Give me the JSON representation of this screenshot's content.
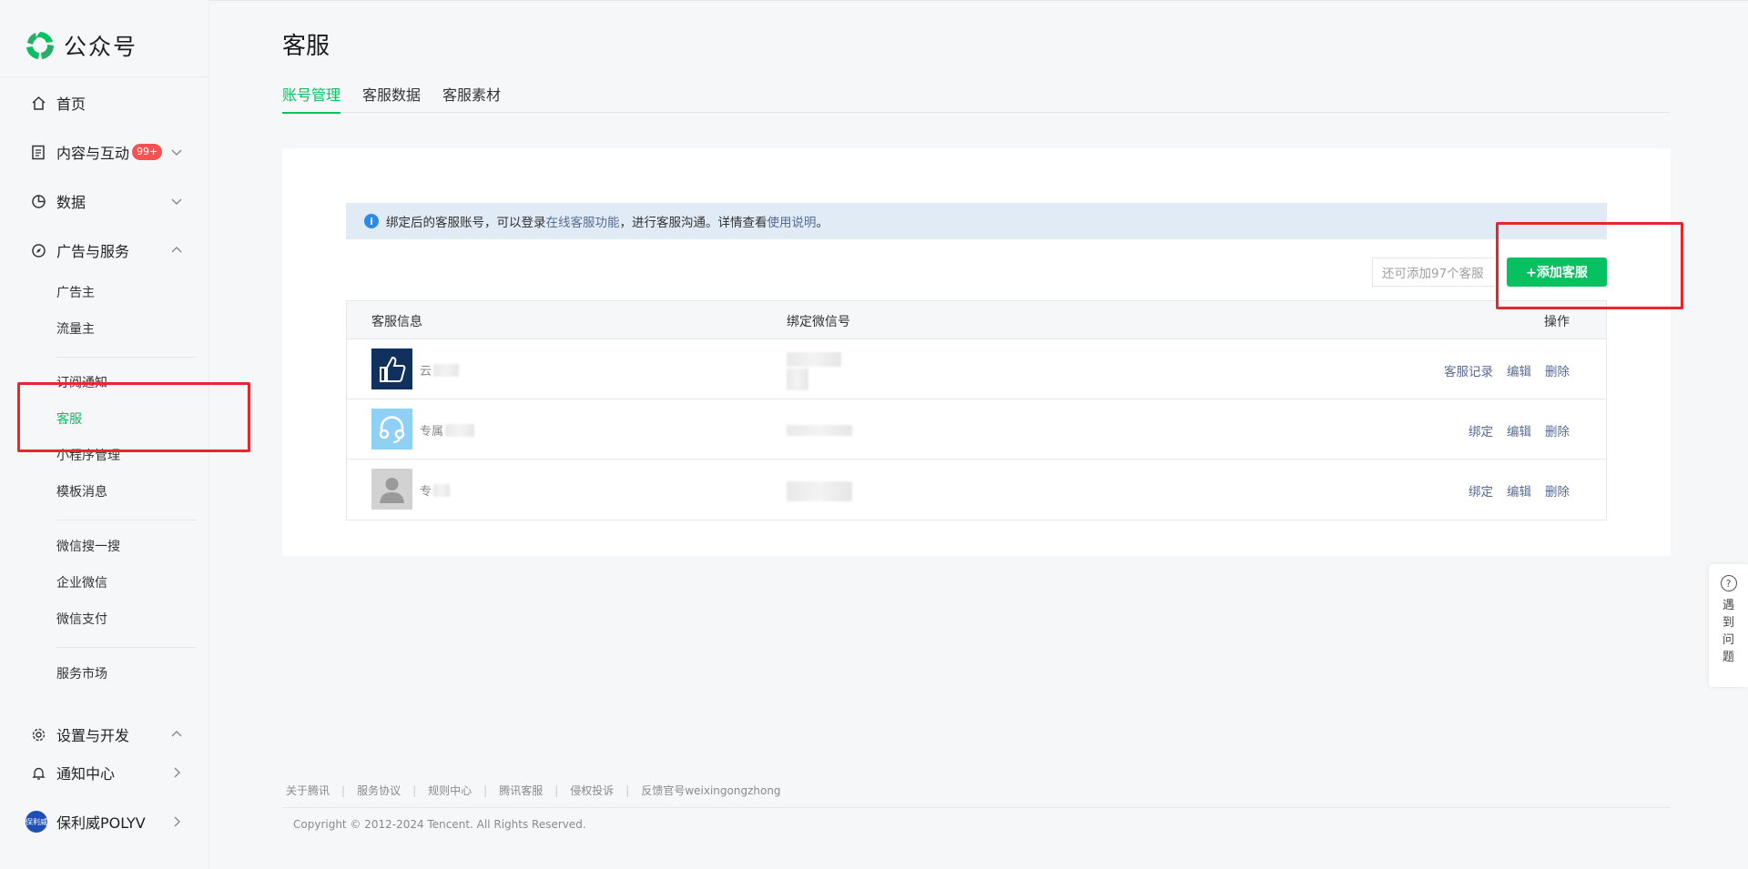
{
  "brand": {
    "name": "公众号"
  },
  "sidebar": {
    "home": "首页",
    "content": {
      "label": "内容与互动",
      "badge": "99+"
    },
    "data": "数据",
    "ads": {
      "label": "广告与服务",
      "subs": [
        "广告主",
        "流量主",
        "订阅通知",
        "客服",
        "小程序管理",
        "模板消息",
        "微信搜一搜",
        "企业微信",
        "微信支付",
        "服务市场"
      ]
    },
    "settings": "设置与开发",
    "notify": "通知中心",
    "account": {
      "name": "保利威POLYV",
      "avatar_text": "保利威"
    }
  },
  "page": {
    "title": "客服",
    "tabs": [
      "账号管理",
      "客服数据",
      "客服素材"
    ]
  },
  "notice": {
    "text1": "绑定后的客服账号，可以登录",
    "link1": "在线客服功能",
    "text2": "，进行客服沟通。详情查看",
    "link2": "使用说明",
    "text3": "。"
  },
  "remain_text": "还可添加97个客服",
  "add_button": "+添加客服",
  "table": {
    "headers": {
      "info": "客服信息",
      "wechat": "绑定微信号",
      "ops": "操作"
    },
    "rows": [
      {
        "name": "云",
        "ops": [
          "客服记录",
          "编辑",
          "删除"
        ]
      },
      {
        "name": "专属",
        "ops": [
          "绑定",
          "编辑",
          "删除"
        ]
      },
      {
        "name": "专",
        "ops": [
          "绑定",
          "编辑",
          "删除"
        ]
      }
    ]
  },
  "footer": {
    "links": [
      "关于腾讯",
      "服务协议",
      "规则中心",
      "腾讯客服",
      "侵权投诉",
      "反馈官号weixingongzhong"
    ],
    "copyright": "Copyright © 2012-2024 Tencent. All Rights Reserved."
  },
  "help": {
    "icon": "?",
    "label": "遇到问题"
  },
  "colors": {
    "accent": "#07c160",
    "link": "#576b95",
    "highlight": "#e8262b"
  }
}
